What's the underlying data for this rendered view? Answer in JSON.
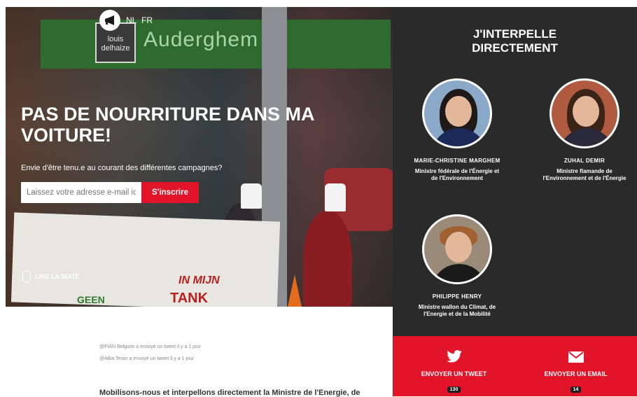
{
  "header": {
    "lang_nl": "NL",
    "lang_fr": "FR"
  },
  "hero": {
    "background_sign_logo": "louis delhaize",
    "background_sign_text": "Auderghem",
    "banner_text_1": "IN MIJN",
    "banner_text_2": "TANK",
    "banner_text_3": "GEEN",
    "title": "PAS DE NOURRITURE DANS MA VOITURE!",
    "subtitle": "Envie d'être tenu.e au courant des différentes campagnes?",
    "email_placeholder": "Laissez votre adresse e-mail ic",
    "subscribe_label": "S'inscrire",
    "read_more": "LIRE LA SUITE"
  },
  "sidebar": {
    "title_line1": "J'INTERPELLE",
    "title_line2": "DIRECTEMENT",
    "people": [
      {
        "name": "MARIE-CHRISTINE MARGHEM",
        "role": "Ministre fédérale de l'Énergie et de l'Environnement"
      },
      {
        "name": "ZUHAL DEMIR",
        "role": "Ministre flamande de l'Environnement et de l'Énergie"
      },
      {
        "name": "PHILIPPE HENRY",
        "role": "Ministre wallon du Climat, de l'Energie et de la Mobilité"
      }
    ]
  },
  "actions": {
    "tweet_label": "ENVOYER UN TWEET",
    "tweet_count": "130",
    "email_label": "ENVOYER UN EMAIL",
    "email_count": "14"
  },
  "feed": {
    "item1": "@FIAN Belgium a envoyé un tweet il y a 1 jour",
    "item2": "@Alba Teran a envoyé un tweet il y a 1 jour"
  },
  "intro": "Mobilisons-nous et interpellons directement la Ministre de l'Energie, de",
  "colors": {
    "accent": "#e2142a",
    "sidebar_bg": "#2a2a2a"
  }
}
